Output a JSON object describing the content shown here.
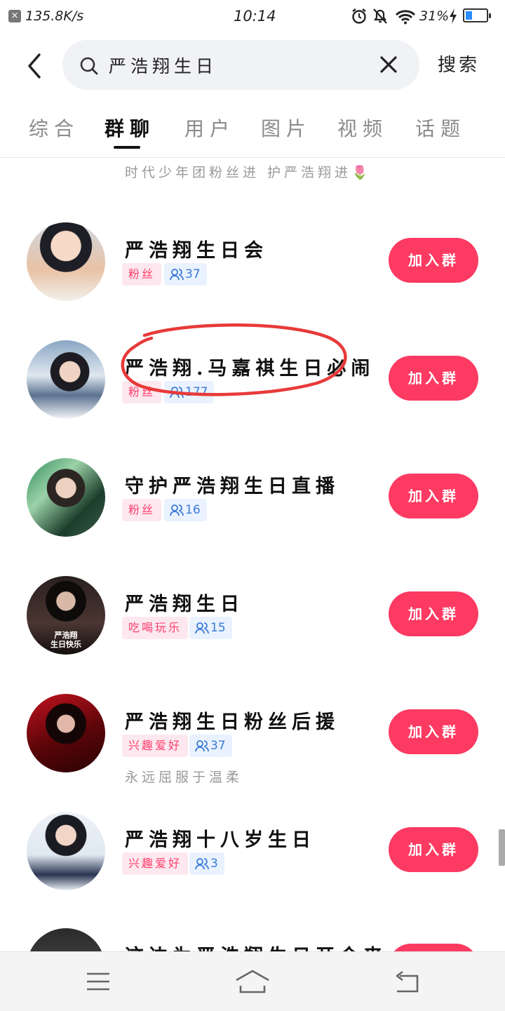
{
  "status_bar": {
    "net_speed": "135.8K/s",
    "time": "10:14",
    "battery": "31%",
    "battery_level": 0.31
  },
  "search": {
    "query": "严浩翔生日",
    "button_label": "搜索"
  },
  "tabs": [
    "综合",
    "群聊",
    "用户",
    "图片",
    "视频",
    "话题"
  ],
  "active_tab": "群聊",
  "partial_top_item": {
    "desc": "时代少年团粉丝进 护严浩翔进🌷"
  },
  "groups": [
    {
      "name": "严浩翔生日会",
      "tag": "粉丝",
      "members": "37",
      "desc": "",
      "join_label": "加入群"
    },
    {
      "name": "严浩翔.马嘉祺生日必闹",
      "tag": "粉丝",
      "members": "177",
      "desc": "",
      "join_label": "加入群"
    },
    {
      "name": "守护严浩翔生日直播",
      "tag": "粉丝",
      "members": "16",
      "desc": "",
      "join_label": "加入群"
    },
    {
      "name": "严浩翔生日",
      "tag": "吃喝玩乐",
      "members": "15",
      "desc": "",
      "join_label": "加入群"
    },
    {
      "name": "严浩翔生日粉丝后援",
      "tag": "兴趣爱好",
      "members": "37",
      "desc": "永远屈服于温柔",
      "join_label": "加入群"
    },
    {
      "name": "严浩翔十八岁生日",
      "tag": "兴趣爱好",
      "members": "3",
      "desc": "",
      "join_label": "加入群"
    }
  ],
  "partial_bottom_item": {
    "name": "这边为严浩翔生日开会来"
  },
  "avatar_texts": {
    "item4_line1": "严浩翔",
    "item4_line2": "生日快乐"
  },
  "colors": {
    "accent": "#fd3a62",
    "tag_text": "#ff3d6b",
    "tag_bg": "#fde8ef",
    "count_text": "#3c7bd6",
    "count_bg": "#e9f2fe"
  }
}
